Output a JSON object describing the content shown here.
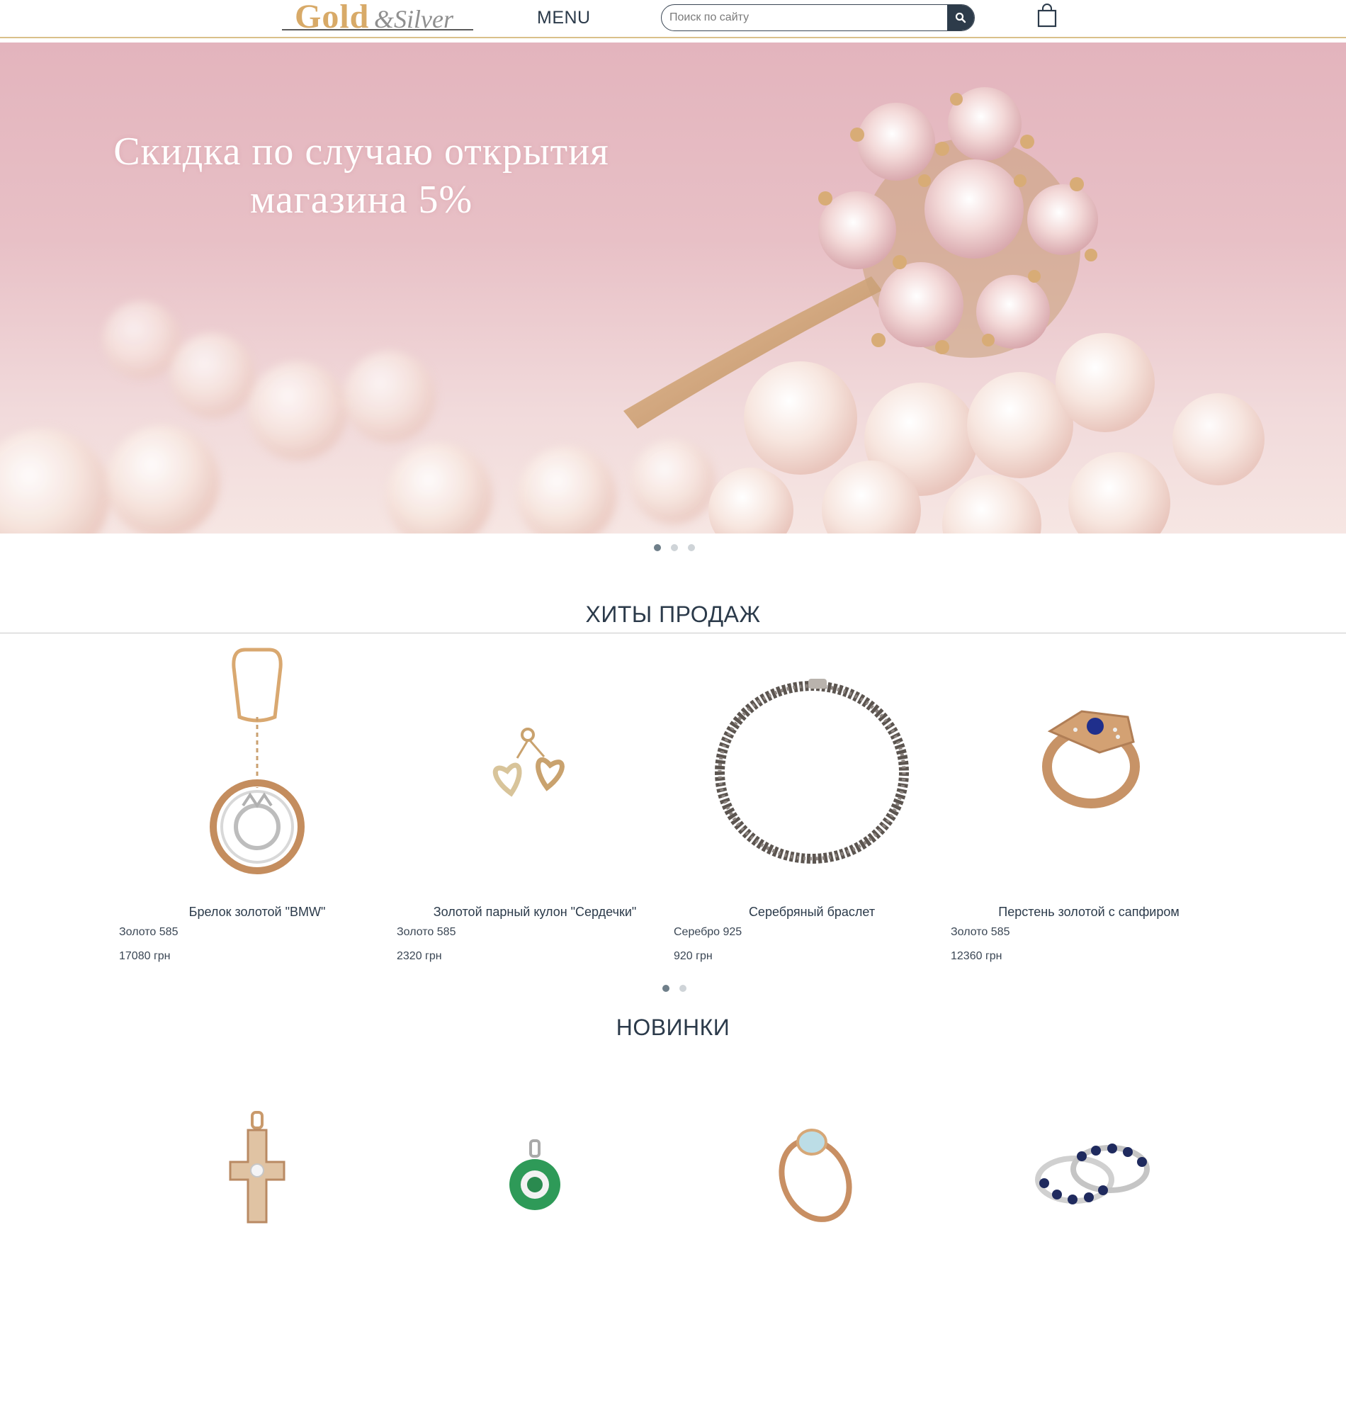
{
  "header": {
    "logo_gold": "Gold",
    "logo_silver": "&Silver",
    "menu_label": "MENU",
    "search_placeholder": "Поиск по сайту",
    "search_icon": "search-icon",
    "cart_icon": "shopping-bag-icon"
  },
  "hero": {
    "title_line1": "Скидка по случаю открытия",
    "title_line2": "магазина 5%",
    "slide_count": 3,
    "active_slide": 1
  },
  "bestsellers": {
    "title": "ХИТЫ ПРОДАЖ",
    "active_page": 1,
    "page_count": 2,
    "items": [
      {
        "name": "Брелок золотой \"BMW\"",
        "metal": "Золото 585",
        "price": "17080 грн"
      },
      {
        "name": "Золотой парный кулон \"Сердечки\"",
        "metal": "Золото 585",
        "price": "2320 грн"
      },
      {
        "name": "Серебряный браслет",
        "metal": "Серебро 925",
        "price": "920 грн"
      },
      {
        "name": "Перстень золотой с сапфиром",
        "metal": "Золото 585",
        "price": "12360 грн"
      }
    ]
  },
  "new_arrivals": {
    "title": "НОВИНКИ"
  },
  "colors": {
    "brand_gold": "#d8aa68",
    "text_dark": "#2b3a4a",
    "search_button": "#2d3b4a",
    "hero_pink": "#e3b4bd"
  }
}
